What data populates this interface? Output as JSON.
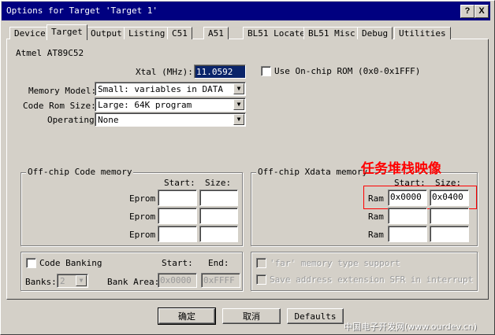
{
  "window": {
    "title": "Options for Target 'Target 1'",
    "help_button": "?",
    "close_button": "X"
  },
  "tabs": [
    "Device",
    "Target",
    "Output",
    "Listing",
    "C51",
    "A51",
    "BL51 Locate",
    "BL51 Misc",
    "Debug",
    "Utilities"
  ],
  "active_tab": "Target",
  "device_name": "Atmel AT89C52",
  "xtal": {
    "label": "Xtal (MHz):",
    "value": "11.0592"
  },
  "use_onchip_rom": {
    "label": "Use On-chip ROM (0x0-0x1FFF)",
    "checked": false
  },
  "memory_model": {
    "label": "Memory Model:",
    "value": "Small: variables in DATA"
  },
  "code_rom_size": {
    "label": "Code Rom Size:",
    "value": "Large: 64K program"
  },
  "operating": {
    "label": "Operating",
    "value": "None"
  },
  "offchip_code": {
    "title": "Off-chip Code memory",
    "start_label": "Start:",
    "size_label": "Size:",
    "rows": [
      {
        "label": "Eprom",
        "start": "",
        "size": ""
      },
      {
        "label": "Eprom",
        "start": "",
        "size": ""
      },
      {
        "label": "Eprom",
        "start": "",
        "size": ""
      }
    ]
  },
  "offchip_xdata": {
    "title": "Off-chip Xdata memory",
    "start_label": "Start:",
    "size_label": "Size:",
    "rows": [
      {
        "label": "Ram",
        "start": "0x0000",
        "size": "0x0400"
      },
      {
        "label": "Ram",
        "start": "",
        "size": ""
      },
      {
        "label": "Ram",
        "start": "",
        "size": ""
      }
    ]
  },
  "annotation": "任务堆栈映像",
  "code_banking": {
    "label": "Code Banking",
    "start_label": "Start:",
    "end_label": "End:",
    "banks_label": "Banks:",
    "banks_value": "2",
    "bank_area_label": "Bank Area:",
    "bank_start": "0x0000",
    "bank_end": "0xFFFF"
  },
  "far_memory": {
    "label": "'far' memory type support"
  },
  "save_address": {
    "label": "Save address extension SFR in interrupt"
  },
  "buttons": {
    "ok": "确定",
    "cancel": "取消",
    "defaults": "Defaults"
  },
  "watermark": "中国电子开发网(www.ourdev.cn)",
  "colors": {
    "titlebar": "#000080",
    "face": "#d4d0c8",
    "selection": "#0a246a",
    "annotation": "#ff0000"
  }
}
